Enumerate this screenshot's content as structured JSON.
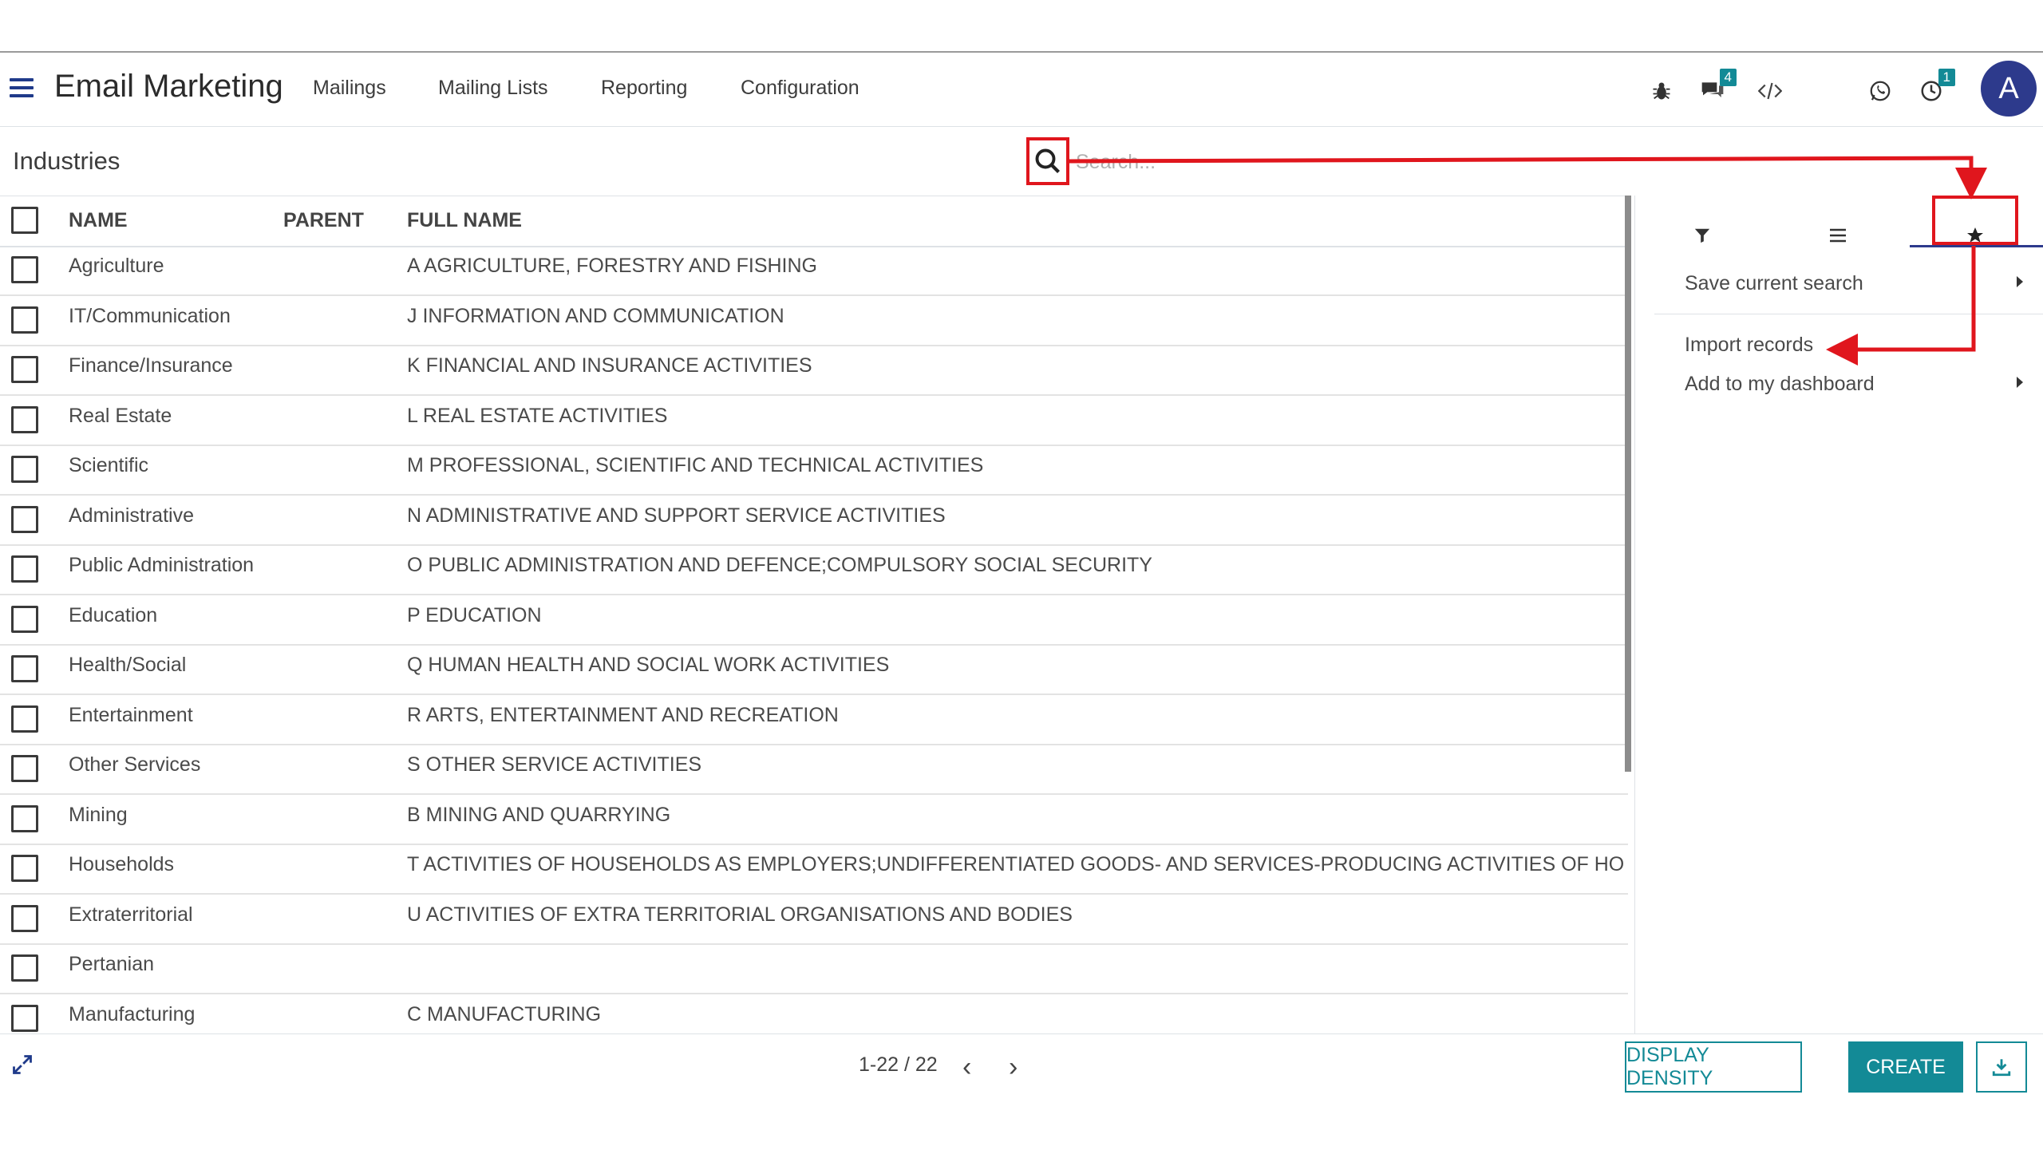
{
  "navbar": {
    "app_title": "Email Marketing",
    "menu_items": [
      "Mailings",
      "Mailing Lists",
      "Reporting",
      "Configuration"
    ],
    "icons": [
      "bug-icon",
      "chat-icon",
      "code-icon",
      "whatsapp-icon",
      "activity-icon"
    ],
    "chat_badge": "4",
    "activity_badge": "1",
    "avatar_letter": "A"
  },
  "control_panel": {
    "breadcrumb": "Industries",
    "search_placeholder": "Search..."
  },
  "table": {
    "columns": [
      "NAME",
      "PARENT",
      "FULL NAME"
    ],
    "rows": [
      {
        "name": "Agriculture",
        "parent": "",
        "full_name": "A AGRICULTURE, FORESTRY AND FISHING"
      },
      {
        "name": "IT/Communication",
        "parent": "",
        "full_name": "J INFORMATION AND COMMUNICATION"
      },
      {
        "name": "Finance/Insurance",
        "parent": "",
        "full_name": "K FINANCIAL AND INSURANCE ACTIVITIES"
      },
      {
        "name": "Real Estate",
        "parent": "",
        "full_name": "L REAL ESTATE ACTIVITIES"
      },
      {
        "name": "Scientific",
        "parent": "",
        "full_name": "M PROFESSIONAL, SCIENTIFIC AND TECHNICAL ACTIVITIES"
      },
      {
        "name": "Administrative",
        "parent": "",
        "full_name": "N ADMINISTRATIVE AND SUPPORT SERVICE ACTIVITIES"
      },
      {
        "name": "Public Administration",
        "parent": "",
        "full_name": "O PUBLIC ADMINISTRATION AND DEFENCE;COMPULSORY SOCIAL SECURITY"
      },
      {
        "name": "Education",
        "parent": "",
        "full_name": "P EDUCATION"
      },
      {
        "name": "Health/Social",
        "parent": "",
        "full_name": "Q HUMAN HEALTH AND SOCIAL WORK ACTIVITIES"
      },
      {
        "name": "Entertainment",
        "parent": "",
        "full_name": "R ARTS, ENTERTAINMENT AND RECREATION"
      },
      {
        "name": "Other Services",
        "parent": "",
        "full_name": "S OTHER SERVICE ACTIVITIES"
      },
      {
        "name": "Mining",
        "parent": "",
        "full_name": "B MINING AND QUARRYING"
      },
      {
        "name": "Households",
        "parent": "",
        "full_name": "T ACTIVITIES OF HOUSEHOLDS AS EMPLOYERS;UNDIFFERENTIATED GOODS- AND SERVICES-PRODUCING ACTIVITIES OF HOUSEHOLDS FOR OWN USE"
      },
      {
        "name": "Extraterritorial",
        "parent": "",
        "full_name": "U ACTIVITIES OF EXTRA TERRITORIAL ORGANISATIONS AND BODIES"
      },
      {
        "name": "Pertanian",
        "parent": "",
        "full_name": ""
      },
      {
        "name": "Manufacturing",
        "parent": "",
        "full_name": "C MANUFACTURING"
      }
    ]
  },
  "favorites_panel": {
    "tabs": [
      "filter-icon",
      "group-by-icon",
      "favorites-star-icon"
    ],
    "active_tab": "favorites",
    "items": [
      "Save current search",
      "Import records",
      "Add to my dashboard"
    ]
  },
  "footer": {
    "pager": "1-22 / 22",
    "display_density_label": "DISPLAY DENSITY",
    "create_label": "CREATE"
  },
  "colors": {
    "accent": "#138a96",
    "brand_dark": "#2d3a8c",
    "annotation_red": "#e0161d"
  }
}
